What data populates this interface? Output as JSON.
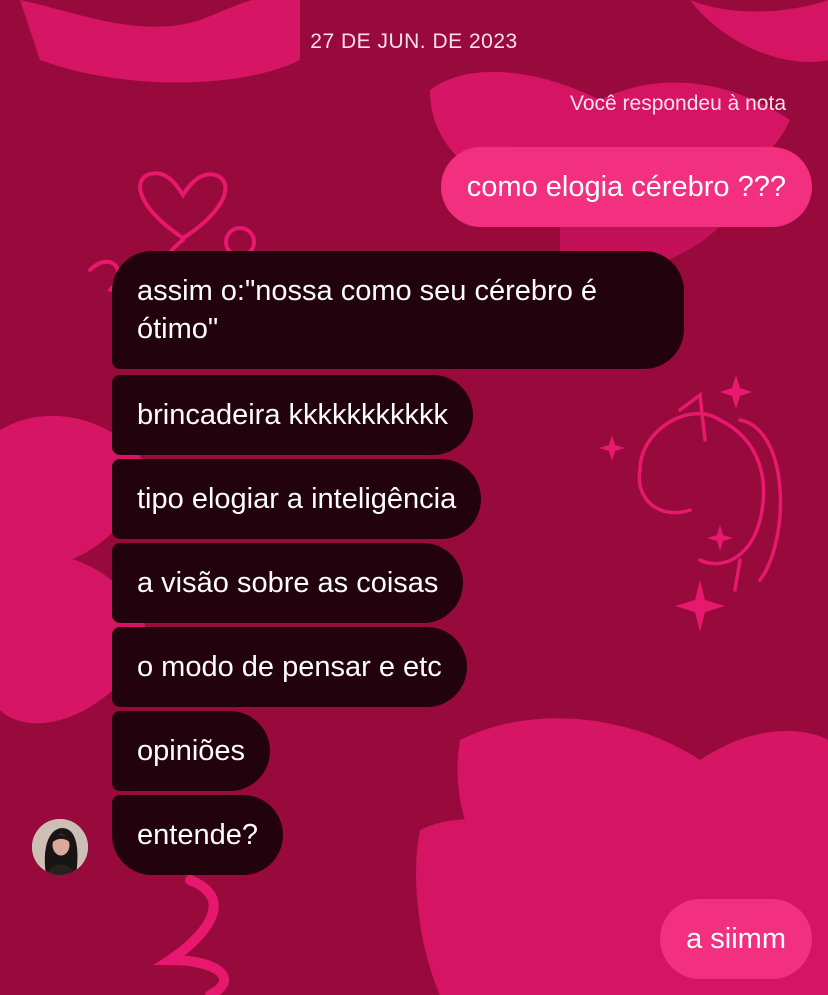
{
  "conversation": {
    "date_header": "27 DE JUN. DE 2023",
    "note_reply_label": "Você respondeu à nota",
    "messages": [
      {
        "side": "sent",
        "text": "como elogia cérebro ???"
      },
      {
        "side": "received",
        "text": "assim o:\"nossa como seu cérebro é ótimo\""
      },
      {
        "side": "received",
        "text": "brincadeira kkkkkkkkkkk"
      },
      {
        "side": "received",
        "text": "tipo elogiar a inteligência"
      },
      {
        "side": "received",
        "text": "a visão sobre as coisas"
      },
      {
        "side": "received",
        "text": "o modo de pensar e etc"
      },
      {
        "side": "received",
        "text": "opiniões"
      },
      {
        "side": "received",
        "text": "entende?"
      },
      {
        "side": "sent",
        "text": "a siimm"
      }
    ]
  },
  "colors": {
    "background": "#9a0a3a",
    "sent_bubble": "#f2307f",
    "received_bubble": "#22020c",
    "theme_accent": "#e8186e"
  },
  "icons": {
    "avatar": "contact-avatar",
    "theme_decorations": [
      "kiss-lips-pattern",
      "heart-doodle",
      "unicorn-doodle",
      "sparkle-doodle"
    ]
  }
}
